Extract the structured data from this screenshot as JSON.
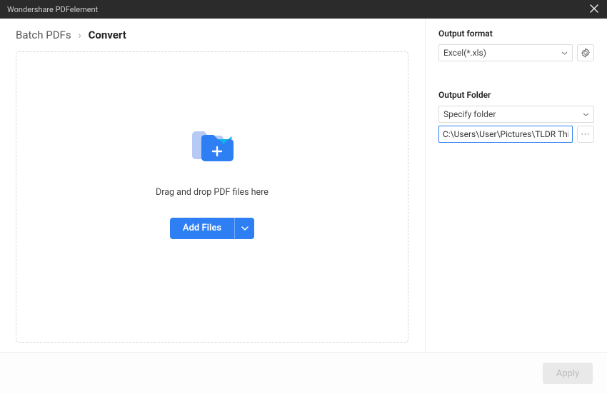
{
  "window": {
    "title": "Wondershare PDFelement"
  },
  "breadcrumb": {
    "root": "Batch PDFs",
    "current": "Convert"
  },
  "dropzone": {
    "hint": "Drag and drop PDF files here",
    "add_files_label": "Add Files"
  },
  "side": {
    "output_format_label": "Output format",
    "output_format_value": "Excel(*.xls)",
    "output_folder_label": "Output Folder",
    "folder_mode_value": "Specify folder",
    "folder_path_value": "C:\\Users\\User\\Pictures\\TLDR This",
    "browse_label": "···"
  },
  "footer": {
    "apply_label": "Apply"
  }
}
